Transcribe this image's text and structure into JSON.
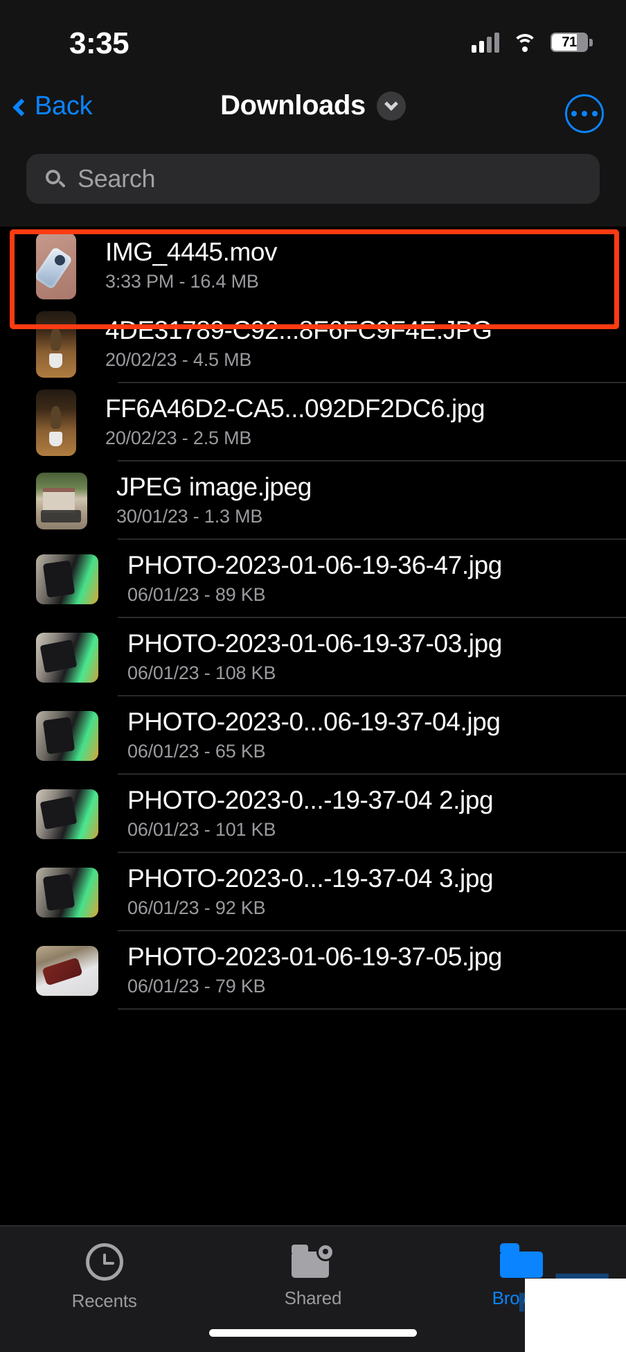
{
  "status_bar": {
    "time": "3:35",
    "cellular_icon": "cellular-bars-icon",
    "cellular_bars_active": 2,
    "wifi_icon": "wifi-icon",
    "battery_icon": "battery-icon",
    "battery_percent": "71"
  },
  "nav_bar": {
    "back_label": "Back",
    "back_icon": "chevron-left-icon",
    "title": "Downloads",
    "title_chevron_icon": "chevron-down-icon",
    "more_icon": "more-options-icon"
  },
  "search": {
    "placeholder": "Search",
    "value": "",
    "icon": "search-icon"
  },
  "files": [
    {
      "name": "IMG_4445.mov",
      "meta": "3:33 PM - 16.4 MB",
      "thumb": "phone-on-pink-surface",
      "highlighted": true
    },
    {
      "name": "4DE31789-C92...8F6FC9F4E.JPG",
      "meta": "20/02/23 - 4.5 MB",
      "thumb": "plant-in-white-pot",
      "highlighted": false
    },
    {
      "name": "FF6A46D2-CA5...092DF2DC6.jpg",
      "meta": "20/02/23 - 2.5 MB",
      "thumb": "plant-in-white-pot",
      "highlighted": false
    },
    {
      "name": "JPEG image.jpeg",
      "meta": "30/01/23 - 1.3 MB",
      "thumb": "house-with-motorcycles",
      "highlighted": false
    },
    {
      "name": "PHOTO-2023-01-06-19-36-47.jpg",
      "meta": "06/01/23 - 89 KB",
      "thumb": "hand-holding-phone-green-light",
      "highlighted": false
    },
    {
      "name": "PHOTO-2023-01-06-19-37-03.jpg",
      "meta": "06/01/23 - 108 KB",
      "thumb": "phone-on-laptop-green-light",
      "highlighted": false
    },
    {
      "name": "PHOTO-2023-0...06-19-37-04.jpg",
      "meta": "06/01/23 - 65 KB",
      "thumb": "hand-holding-phone-green-light",
      "highlighted": false
    },
    {
      "name": "PHOTO-2023-0...-19-37-04 2.jpg",
      "meta": "06/01/23 - 101 KB",
      "thumb": "phone-on-laptop-green-light",
      "highlighted": false
    },
    {
      "name": "PHOTO-2023-0...-19-37-04 3.jpg",
      "meta": "06/01/23 - 92 KB",
      "thumb": "hand-holding-phone-green-light",
      "highlighted": false
    },
    {
      "name": "PHOTO-2023-01-06-19-37-05.jpg",
      "meta": "06/01/23 - 79 KB",
      "thumb": "red-phone-on-desk",
      "highlighted": false
    }
  ],
  "tab_bar": {
    "tabs": [
      {
        "label": "Recents",
        "icon": "clock-icon",
        "active": false
      },
      {
        "label": "Shared",
        "icon": "shared-folder-icon",
        "active": false
      },
      {
        "label": "Browse",
        "icon": "folder-icon",
        "active": true
      }
    ]
  },
  "annotation": {
    "highlight_color": "#ff3b12",
    "target_row": "IMG_4445.mov"
  },
  "colors": {
    "accent_blue": "#0a84ff",
    "background": "#000000",
    "header_background": "#141414",
    "secondary_text": "#9a9a9f",
    "highlight_red": "#ff3b12"
  }
}
